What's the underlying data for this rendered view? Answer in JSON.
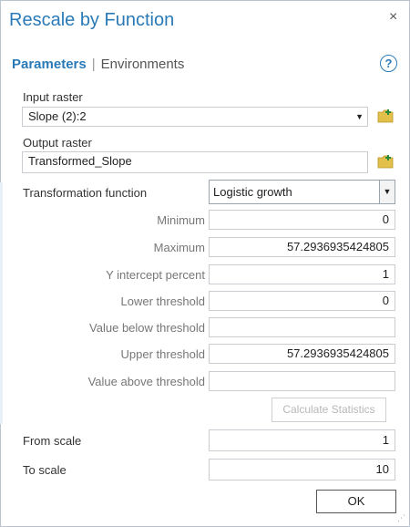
{
  "dialog": {
    "title": "Rescale by Function",
    "close_glyph": "×"
  },
  "tabs": {
    "active": "Parameters",
    "separator": "|",
    "inactive": "Environments"
  },
  "help": {
    "glyph": "?"
  },
  "input_raster": {
    "label": "Input raster",
    "value": "Slope (2):2",
    "dropdown_glyph": "▼"
  },
  "output_raster": {
    "label": "Output raster",
    "value": "Transformed_Slope"
  },
  "transformation": {
    "label": "Transformation function",
    "value": "Logistic growth",
    "dropdown_glyph": "▼"
  },
  "params": [
    {
      "label": "Minimum",
      "value": "0"
    },
    {
      "label": "Maximum",
      "value": "57.2936935424805"
    },
    {
      "label": "Y intercept percent",
      "value": "1"
    },
    {
      "label": "Lower threshold",
      "value": "0"
    },
    {
      "label": "Value below threshold",
      "value": ""
    },
    {
      "label": "Upper threshold",
      "value": "57.2936935424805"
    },
    {
      "label": "Value above threshold",
      "value": ""
    }
  ],
  "calculate": {
    "label": "Calculate Statistics"
  },
  "from_scale": {
    "label": "From scale",
    "value": "1"
  },
  "to_scale": {
    "label": "To scale",
    "value": "10"
  },
  "ok": {
    "label": "OK"
  },
  "colors": {
    "accent": "#2a7ab7",
    "folder": "#e3c04a",
    "plus": "#2a8a3a"
  }
}
